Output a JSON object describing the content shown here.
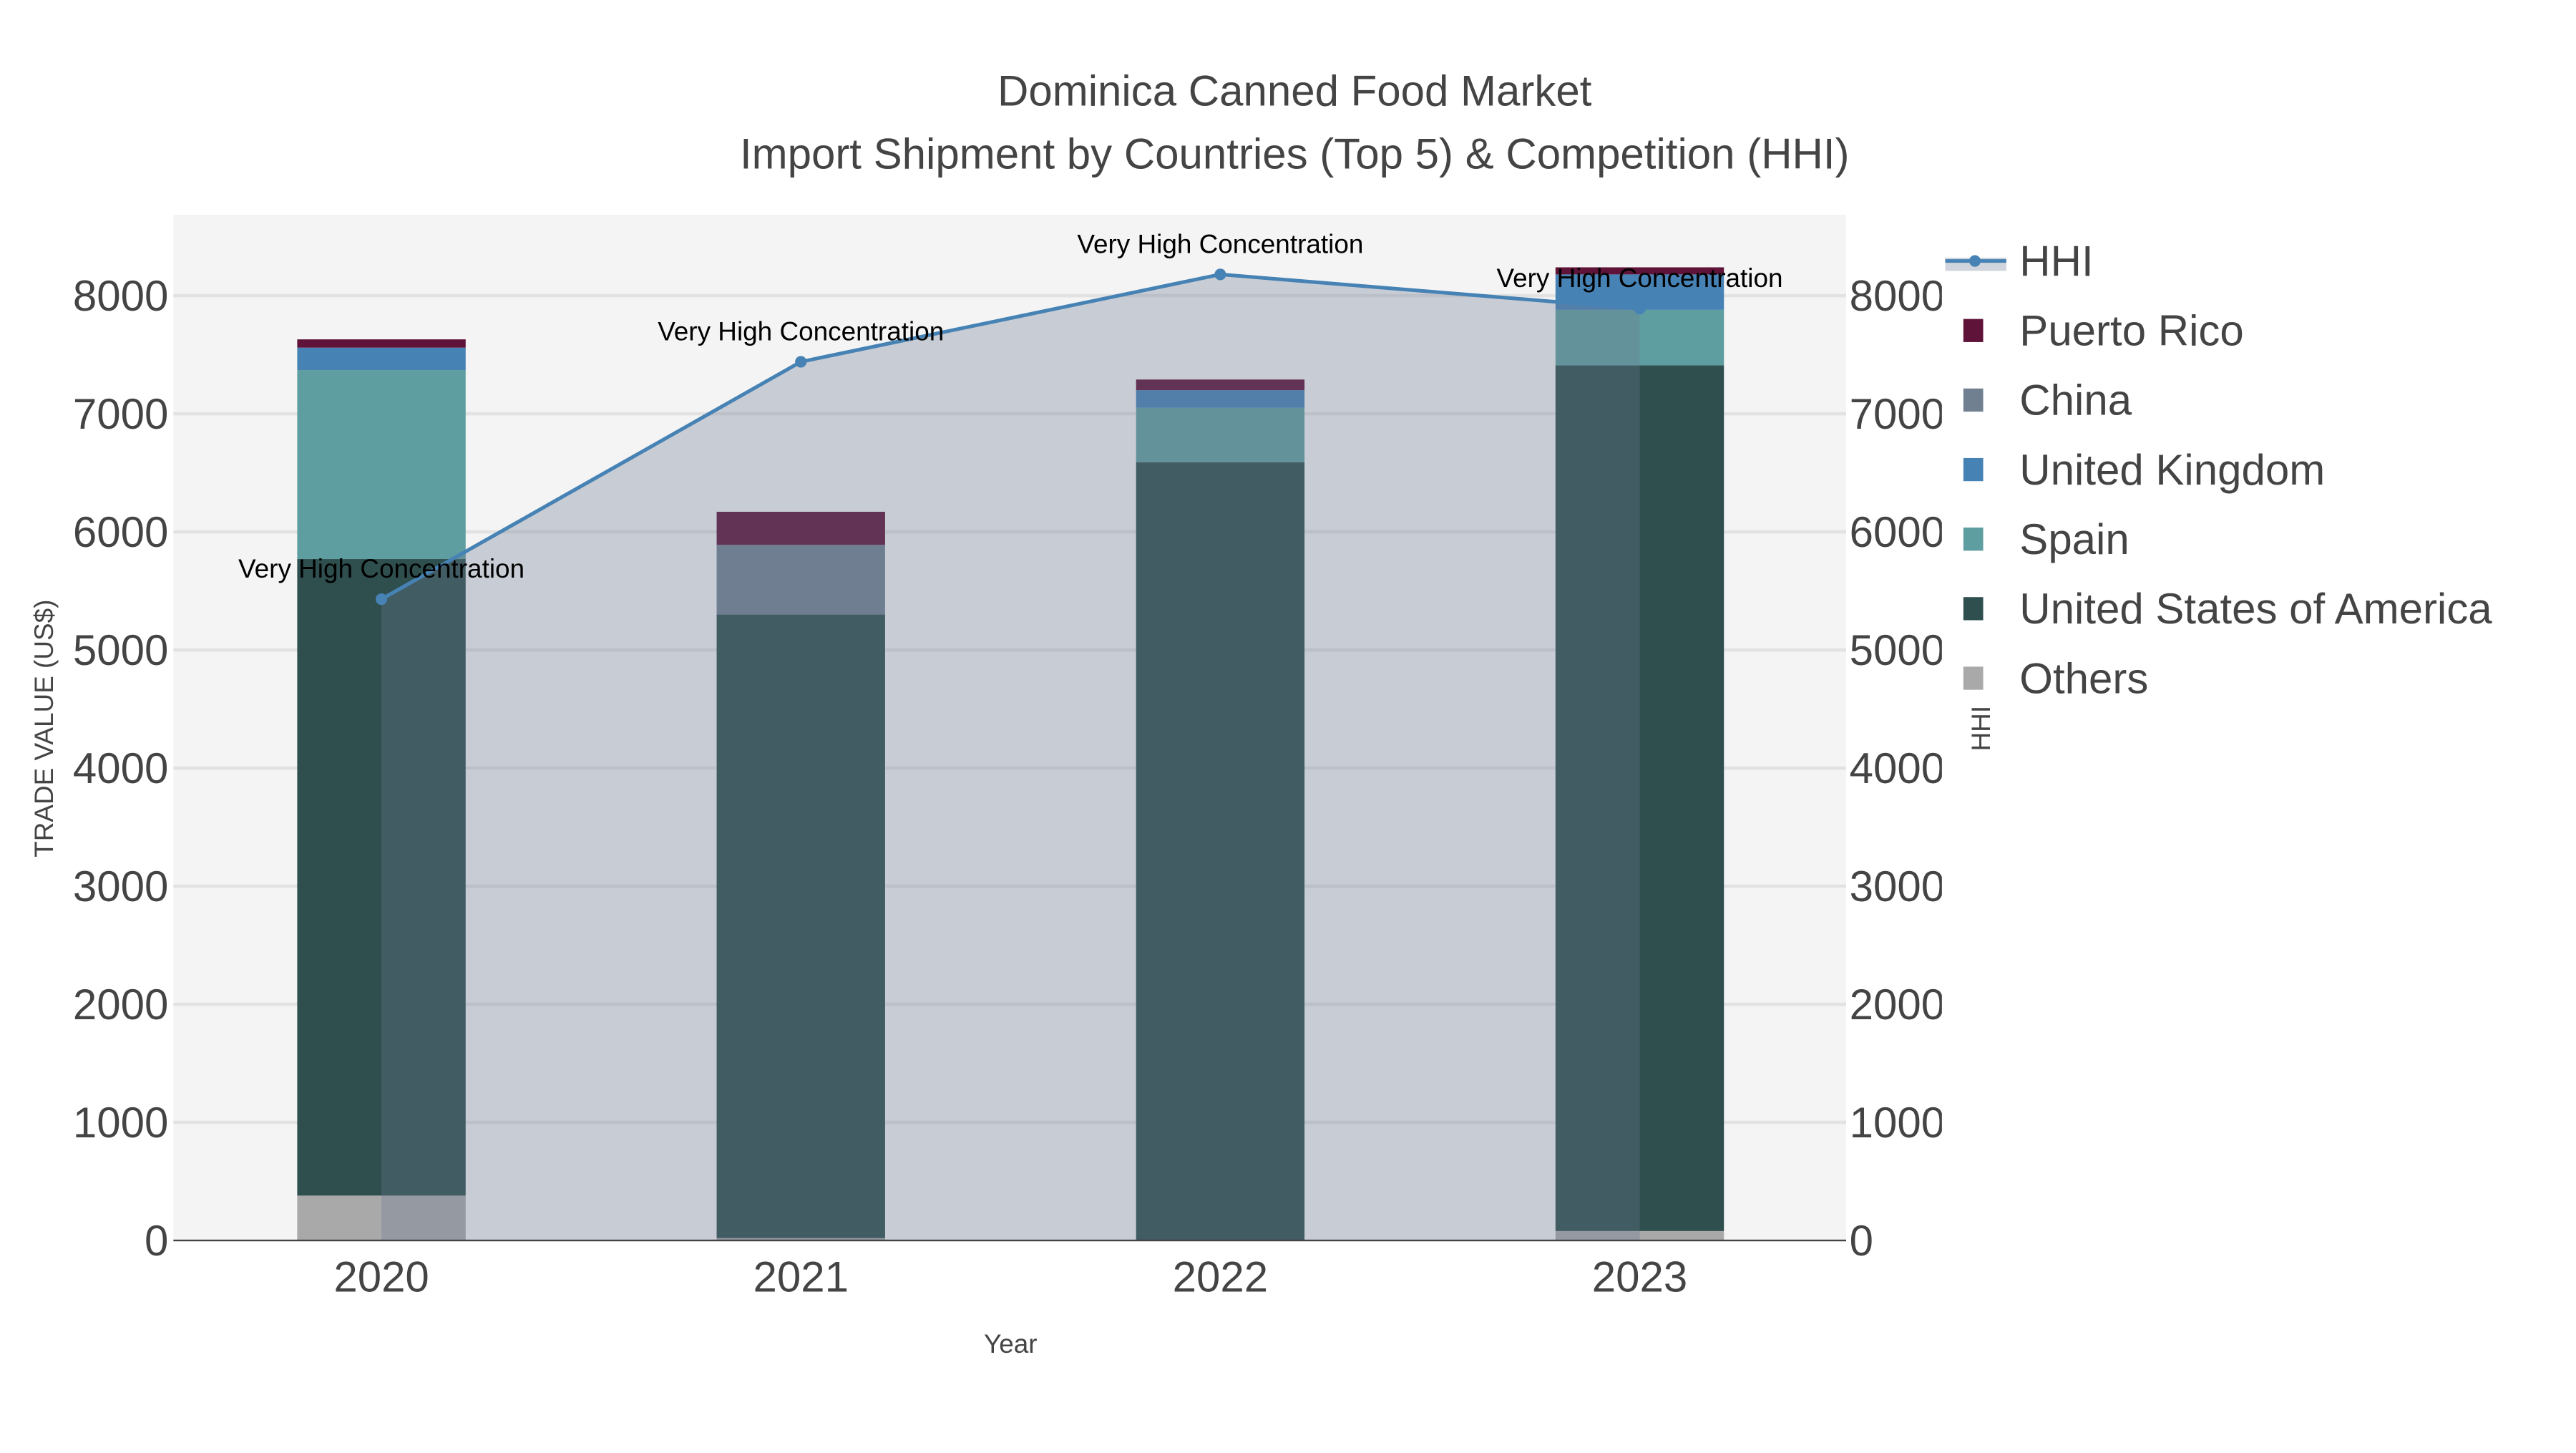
{
  "chart_data": {
    "type": "bar",
    "title": "Dominica Canned Food Market",
    "subtitle": "Import Shipment by Countries (Top 5) & Competition (HHI)",
    "xlabel": "Year",
    "ylabel": "TRADE VALUE (US$)",
    "y2label": "HHI",
    "categories": [
      "2020",
      "2021",
      "2022",
      "2023"
    ],
    "ylim": [
      0,
      8700
    ],
    "yticks": [
      "0",
      "1000",
      "2000",
      "3000",
      "4000",
      "5000",
      "6000",
      "7000",
      "8000"
    ],
    "y2ticks": [
      "0",
      "1000",
      "2000",
      "3000",
      "4000",
      "5000",
      "6000",
      "7000",
      "8000"
    ],
    "stacked": true,
    "series": [
      {
        "name": "Others",
        "color": "#a9a9a9",
        "values": [
          380,
          20,
          0,
          80
        ]
      },
      {
        "name": "United States of America",
        "color": "#2f4f4f",
        "values": [
          5390,
          5280,
          6590,
          7330
        ]
      },
      {
        "name": "Spain",
        "color": "#5f9ea0",
        "values": [
          1600,
          0,
          460,
          470
        ]
      },
      {
        "name": "United Kingdom",
        "color": "#4682b4",
        "values": [
          190,
          0,
          150,
          300
        ]
      },
      {
        "name": "China",
        "color": "#708090",
        "values": [
          0,
          590,
          0,
          0
        ]
      },
      {
        "name": "Puerto Rico",
        "color": "#5f1338",
        "values": [
          70,
          280,
          90,
          60
        ]
      }
    ],
    "hhi": {
      "name": "HHI",
      "color": "#4682b4",
      "values": [
        5430,
        7440,
        8180,
        7890
      ]
    },
    "annotations": [
      "Very High Concentration",
      "Very High Concentration",
      "Very High Concentration",
      "Very High Concentration"
    ],
    "legend": [
      "HHI",
      "Puerto Rico",
      "China",
      "United Kingdom",
      "Spain",
      "United States of America",
      "Others"
    ],
    "legend_position": "right",
    "grid": true
  }
}
